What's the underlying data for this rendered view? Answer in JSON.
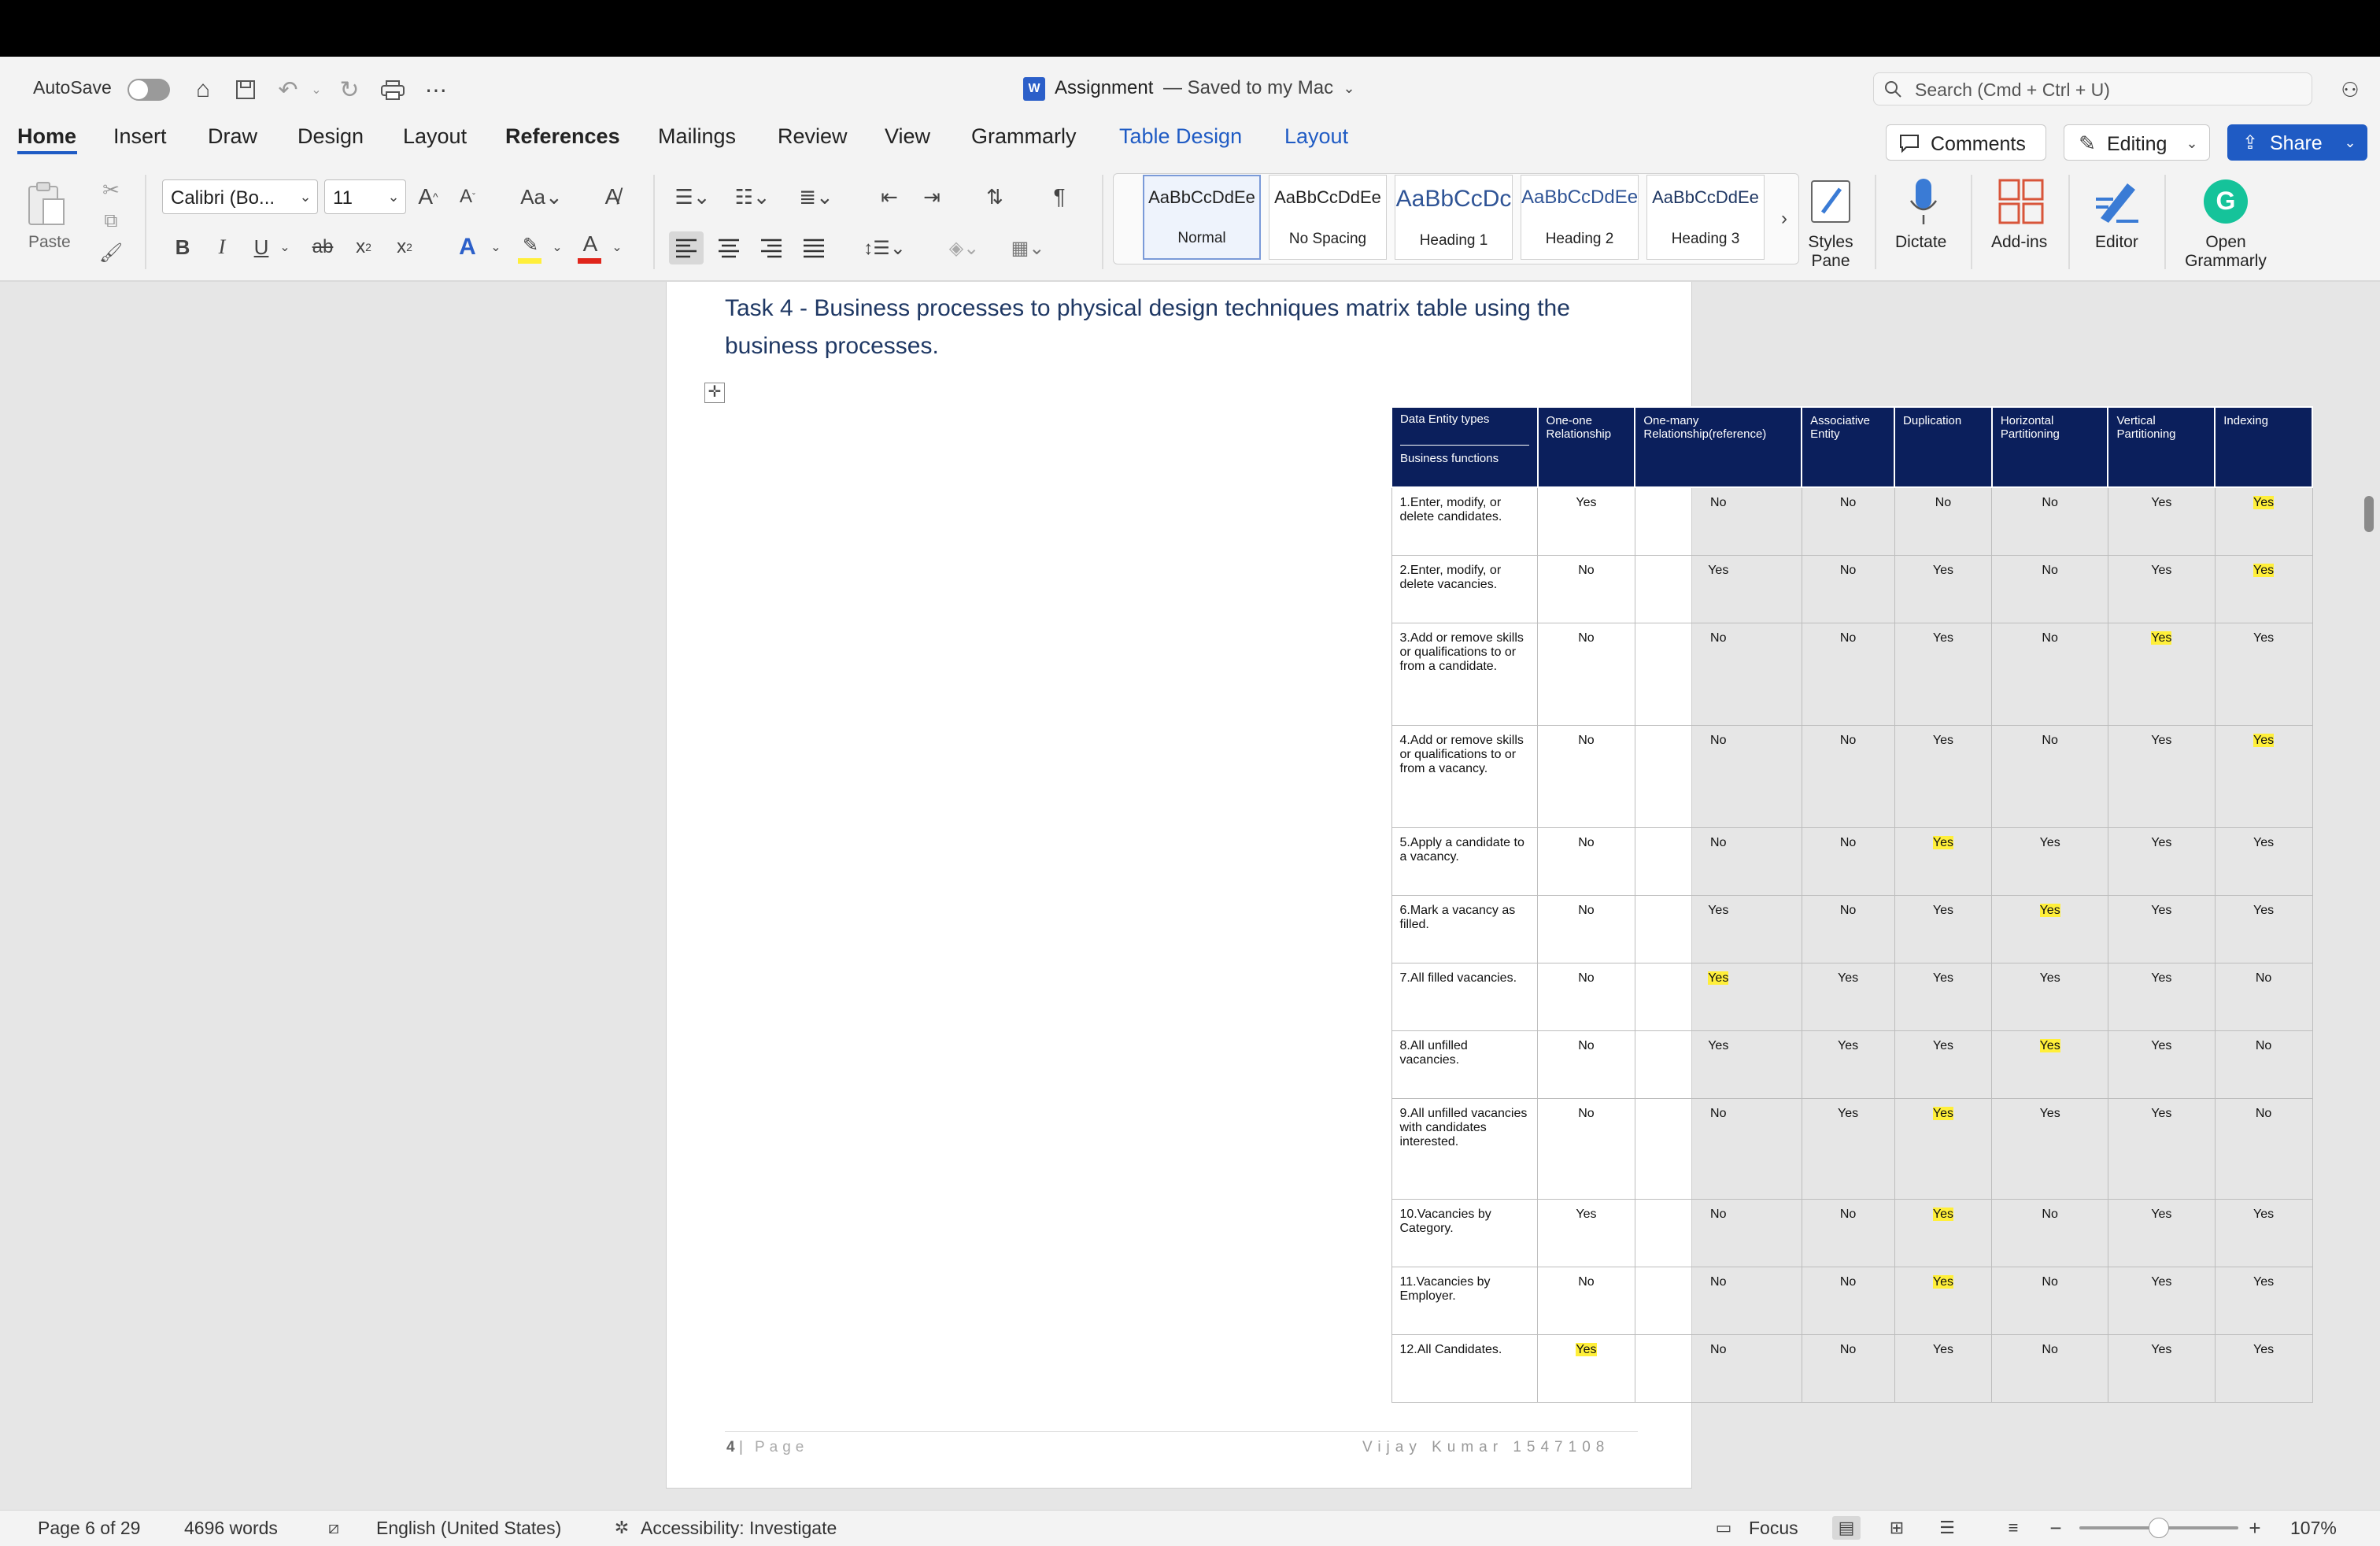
{
  "titlebar": {
    "autosave_label": "AutoSave",
    "doc_title": "Assignment",
    "doc_status": "— Saved to my Mac",
    "search_placeholder": "Search (Cmd + Ctrl + U)"
  },
  "ribbon_tabs": [
    {
      "label": "Home"
    },
    {
      "label": "Insert"
    },
    {
      "label": "Draw"
    },
    {
      "label": "Design"
    },
    {
      "label": "Layout"
    },
    {
      "label": "References"
    },
    {
      "label": "Mailings"
    },
    {
      "label": "Review"
    },
    {
      "label": "View"
    },
    {
      "label": "Grammarly"
    },
    {
      "label": "Table Design"
    },
    {
      "label": "Layout"
    }
  ],
  "right_buttons": {
    "comments": "Comments",
    "editing": "Editing",
    "share": "Share"
  },
  "ribbon": {
    "paste_label": "Paste",
    "font_name": "Calibri (Bo...",
    "font_size": "11",
    "styles": [
      {
        "sample": "AaBbCcDdEe",
        "name": "Normal"
      },
      {
        "sample": "AaBbCcDdEe",
        "name": "No Spacing"
      },
      {
        "sample": "AaBbCcDc",
        "name": "Heading 1"
      },
      {
        "sample": "AaBbCcDdEe",
        "name": "Heading 2"
      },
      {
        "sample": "AaBbCcDdEe",
        "name": "Heading 3"
      }
    ],
    "styles_pane_label": "Styles\nPane",
    "dictate_label": "Dictate",
    "addins_label": "Add-ins",
    "editor_label": "Editor",
    "grammarly_label": "Open\nGrammarly"
  },
  "document": {
    "heading": "Task 4 - Business processes to physical design techniques matrix table using the business processes.",
    "table": {
      "corner_top": "Data Entity types",
      "corner_bottom": "Business functions",
      "columns": [
        "One-one Relationship",
        "One-many Relationship(reference)",
        "Associative Entity",
        "Duplication",
        "Horizontal Partitioning",
        "Vertical Partitioning",
        "Indexing"
      ],
      "rows": [
        {
          "label": "1.Enter, modify, or delete candidates.",
          "cells": [
            "Yes",
            "No",
            "No",
            "No",
            "No",
            "Yes",
            "Yes"
          ],
          "highlight": [
            6
          ]
        },
        {
          "label": "2.Enter, modify, or delete vacancies.",
          "cells": [
            "No",
            "Yes",
            "No",
            "Yes",
            "No",
            "Yes",
            "Yes"
          ],
          "highlight": [
            6
          ]
        },
        {
          "label": "3.Add or remove skills or qualifications to or from a candidate.",
          "cells": [
            "No",
            "No",
            "No",
            "Yes",
            "No",
            "Yes",
            "Yes"
          ],
          "highlight": [
            5
          ]
        },
        {
          "label": "4.Add or remove skills or qualifications to or from a vacancy.",
          "cells": [
            "No",
            "No",
            "No",
            "Yes",
            "No",
            "Yes",
            "Yes"
          ],
          "highlight": [
            6
          ]
        },
        {
          "label": "5.Apply a candidate to a vacancy.",
          "cells": [
            "No",
            "No",
            "No",
            "Yes",
            "Yes",
            "Yes",
            "Yes"
          ],
          "highlight": [
            3
          ]
        },
        {
          "label": "6.Mark a vacancy as filled.",
          "cells": [
            "No",
            "Yes",
            "No",
            "Yes",
            "Yes",
            "Yes",
            "Yes"
          ],
          "highlight": [
            4
          ]
        },
        {
          "label": "7.All filled vacancies.",
          "cells": [
            "No",
            "Yes",
            "Yes",
            "Yes",
            "Yes",
            "Yes",
            "No"
          ],
          "highlight": [
            1
          ]
        },
        {
          "label": "8.All unfilled vacancies.",
          "cells": [
            "No",
            "Yes",
            "Yes",
            "Yes",
            "Yes",
            "Yes",
            "No"
          ],
          "highlight": [
            4
          ]
        },
        {
          "label": "9.All unfilled vacancies with candidates interested.",
          "cells": [
            "No",
            "No",
            "Yes",
            "Yes",
            "Yes",
            "Yes",
            "No"
          ],
          "highlight": [
            3
          ]
        },
        {
          "label": "10.Vacancies by Category.",
          "cells": [
            "Yes",
            "No",
            "No",
            "Yes",
            "No",
            "Yes",
            "Yes"
          ],
          "highlight": [
            3
          ]
        },
        {
          "label": "11.Vacancies by Employer.",
          "cells": [
            "No",
            "No",
            "No",
            "Yes",
            "No",
            "Yes",
            "Yes"
          ],
          "highlight": [
            3
          ]
        },
        {
          "label": "12.All Candidates.",
          "cells": [
            "Yes",
            "No",
            "No",
            "Yes",
            "No",
            "Yes",
            "Yes"
          ],
          "highlight": [
            0
          ]
        }
      ]
    },
    "footer_page_num": "4",
    "footer_page_word": "Page",
    "footer_author": "Vijay Kumar 1547108"
  },
  "statusbar": {
    "page": "Page 6 of 29",
    "words": "4696 words",
    "language": "English (United States)",
    "accessibility": "Accessibility: Investigate",
    "focus": "Focus",
    "zoom": "107%"
  },
  "colors": {
    "header_fill": "#0b1f5c",
    "highlight": "#ffef3a",
    "accent": "#1f5bc4"
  }
}
